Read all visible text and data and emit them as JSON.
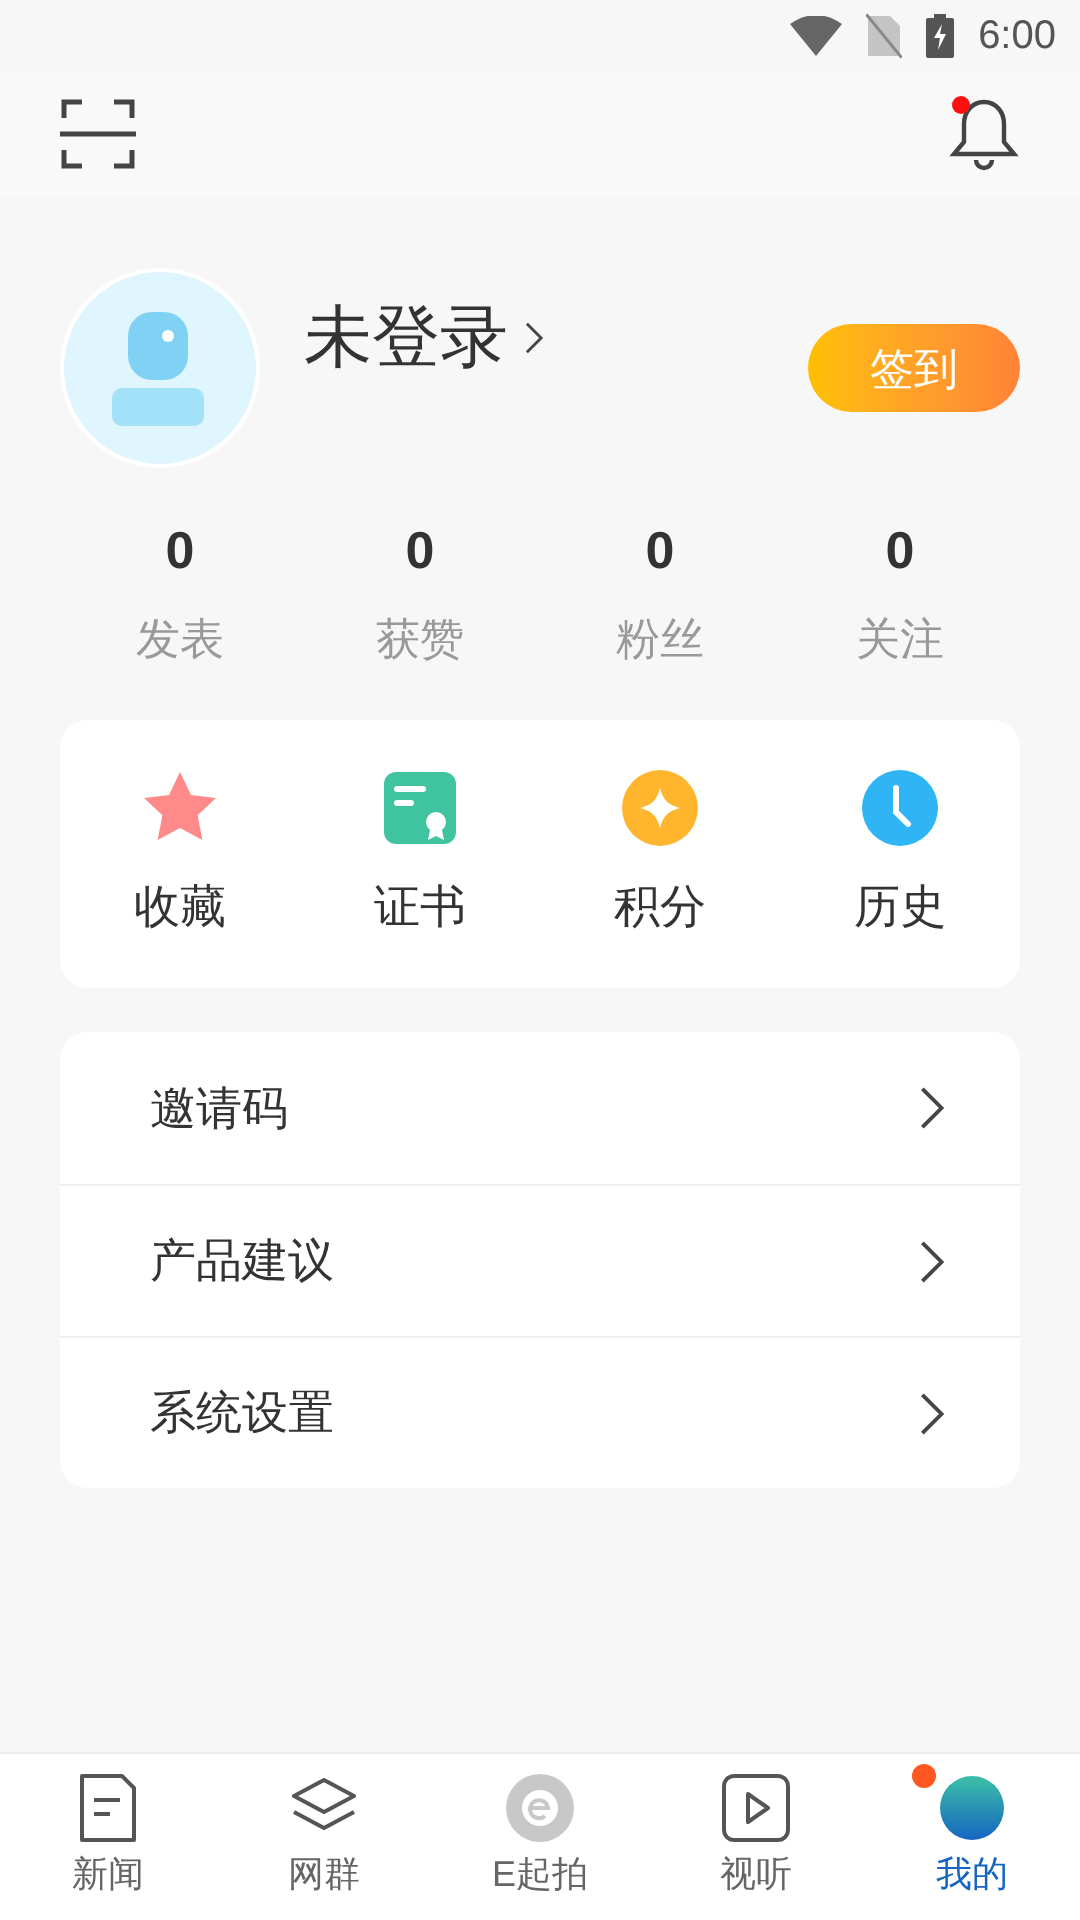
{
  "status_bar": {
    "time": "6:00"
  },
  "header": {
    "notification_dot": true
  },
  "profile": {
    "name": "未登录",
    "checkin_button": "签到"
  },
  "stats": [
    {
      "value": "0",
      "label": "发表"
    },
    {
      "value": "0",
      "label": "获赞"
    },
    {
      "value": "0",
      "label": "粉丝"
    },
    {
      "value": "0",
      "label": "关注"
    }
  ],
  "shortcuts": [
    {
      "kind": "star",
      "label": "收藏"
    },
    {
      "kind": "certificate",
      "label": "证书"
    },
    {
      "kind": "coin",
      "label": "积分"
    },
    {
      "kind": "clock",
      "label": "历史"
    }
  ],
  "menu": [
    "邀请码",
    "产品建议",
    "系统设置"
  ],
  "tab_bar": [
    {
      "kind": "news",
      "label": "新闻",
      "selected": false,
      "badge": false
    },
    {
      "kind": "layers",
      "label": "网群",
      "selected": false,
      "badge": false
    },
    {
      "kind": "e",
      "label": "E起拍",
      "selected": false,
      "badge": false
    },
    {
      "kind": "video",
      "label": "视听",
      "selected": false,
      "badge": false
    },
    {
      "kind": "me",
      "label": "我的",
      "selected": true,
      "badge": true
    }
  ]
}
